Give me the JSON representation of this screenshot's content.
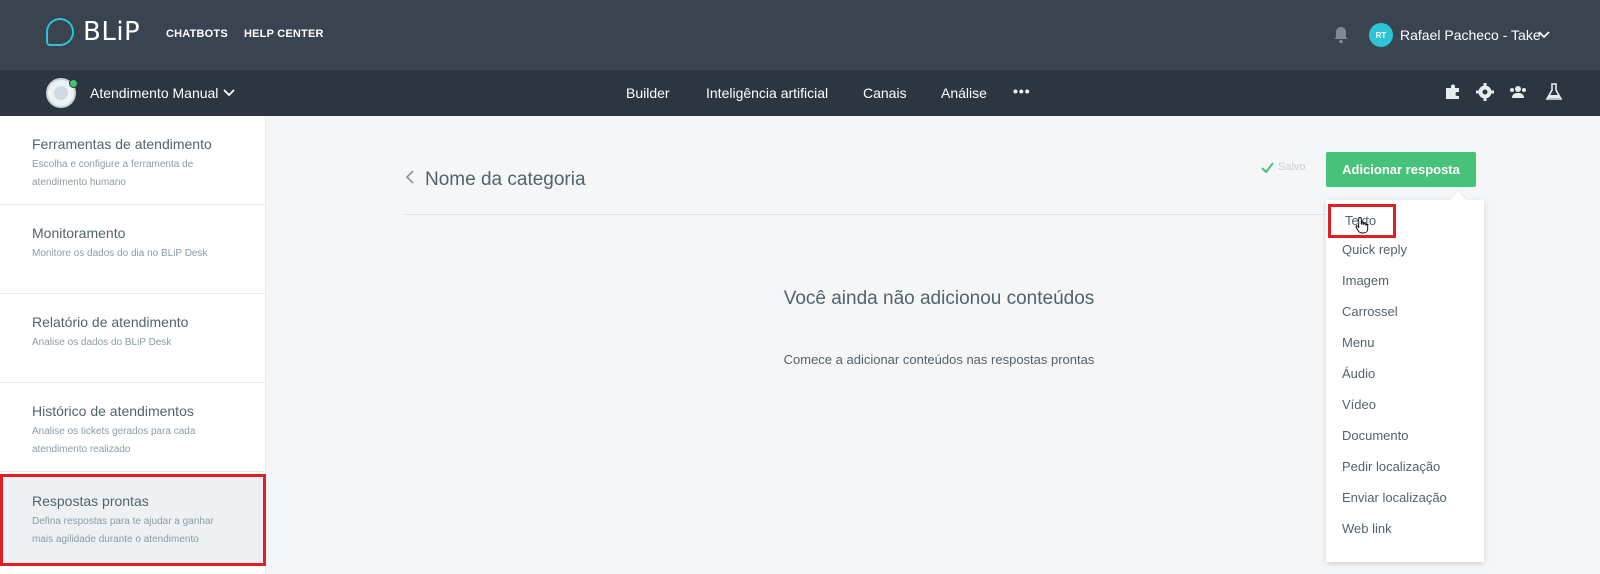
{
  "header": {
    "logo_text": "BLiP",
    "nav": [
      "CHATBOTS",
      "HELP CENTER"
    ],
    "user": {
      "initials": "RT",
      "name": "Rafael Pacheco - Take"
    }
  },
  "subheader": {
    "bot_name": "Atendimento Manual",
    "nav": [
      "Builder",
      "Inteligência artificial",
      "Canais",
      "Análise"
    ],
    "more": "•••"
  },
  "sidebar": {
    "items": [
      {
        "title": "Ferramentas de atendimento",
        "desc": "Escolha e configure a ferramenta de atendimento humano"
      },
      {
        "title": "Monitoramento",
        "desc": "Monitore os dados do dia no BLiP Desk"
      },
      {
        "title": "Relatório de atendimento",
        "desc": "Analise os dados do BLiP Desk"
      },
      {
        "title": "Histórico de atendimentos",
        "desc": "Analise os tickets gerados para cada atendimento realizado"
      },
      {
        "title": "Respostas prontas",
        "desc": "Defina respostas para te ajudar a ganhar mais agilidade durante o atendimento"
      }
    ]
  },
  "main": {
    "category_title": "Nome da categoria",
    "saved_label": "Salvo",
    "add_button": "Adicionar resposta",
    "empty_title": "Você ainda não adicionou conteúdos",
    "empty_subtitle": "Comece a adicionar conteúdos nas respostas prontas"
  },
  "dropdown": {
    "items": [
      "Texto",
      "Quick reply",
      "Imagem",
      "Carrossel",
      "Menu",
      "Áudio",
      "Vídeo",
      "Documento",
      "Pedir localização",
      "Enviar localização",
      "Web link"
    ]
  },
  "colors": {
    "topbar": "#3a4350",
    "subbar": "#2d3540",
    "accent_cyan": "#2cc3d5",
    "accent_green": "#46c27a",
    "highlight_red": "#e01e25"
  }
}
